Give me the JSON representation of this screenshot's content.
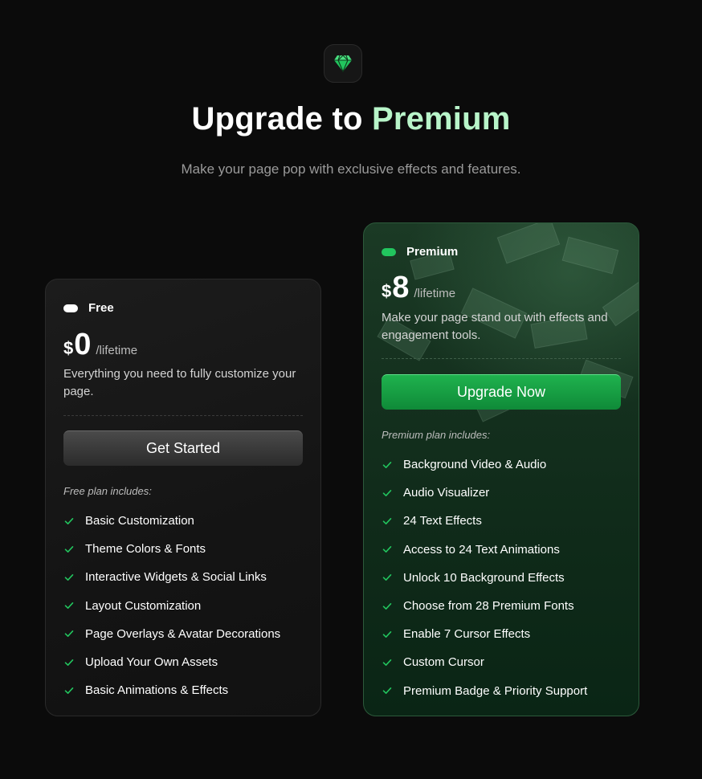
{
  "header": {
    "title_main": "Upgrade to",
    "title_accent": "Premium",
    "subtitle": "Make your page pop with exclusive effects and features.",
    "logo_icon": "diamond-icon"
  },
  "plans": {
    "free": {
      "name": "Free",
      "currency": "$",
      "price": "0",
      "period": "/lifetime",
      "description": "Everything you need to fully customize your page.",
      "button_label": "Get Started",
      "includes_label": "Free plan includes:",
      "features": [
        "Basic Customization",
        "Theme Colors & Fonts",
        "Interactive Widgets & Social Links",
        "Layout Customization",
        "Page Overlays & Avatar Decorations",
        "Upload Your Own Assets",
        "Basic Animations & Effects"
      ]
    },
    "premium": {
      "name": "Premium",
      "currency": "$",
      "price": "8",
      "period": "/lifetime",
      "description": "Make your page stand out with effects and engagement tools.",
      "button_label": "Upgrade Now",
      "includes_label": "Premium plan includes:",
      "features": [
        "Background Video & Audio",
        "Audio Visualizer",
        "24 Text Effects",
        "Access to 24 Text Animations",
        "Unlock 10 Background Effects",
        "Choose from 28 Premium Fonts",
        "Enable 7 Cursor Effects",
        "Custom Cursor",
        "Premium Badge & Priority Support"
      ]
    }
  },
  "colors": {
    "background": "#0b0b0b",
    "accent_text": "#b8f5c9",
    "check_green": "#22c55e",
    "premium_button": "#16a34a"
  }
}
